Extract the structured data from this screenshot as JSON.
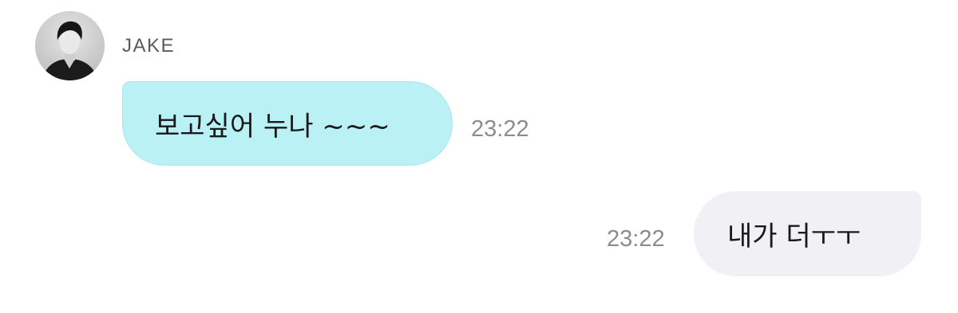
{
  "conversation": {
    "incoming": {
      "sender": "JAKE",
      "avatar_icon": "profile-photo-avatar",
      "text": "보고싶어 누나 ~~~",
      "time": "23:22",
      "bubble_color": "#b9f1f5"
    },
    "outgoing": {
      "text": "내가 더ㅜㅜ",
      "time": "23:22",
      "bubble_color": "#f1f1f5"
    }
  }
}
